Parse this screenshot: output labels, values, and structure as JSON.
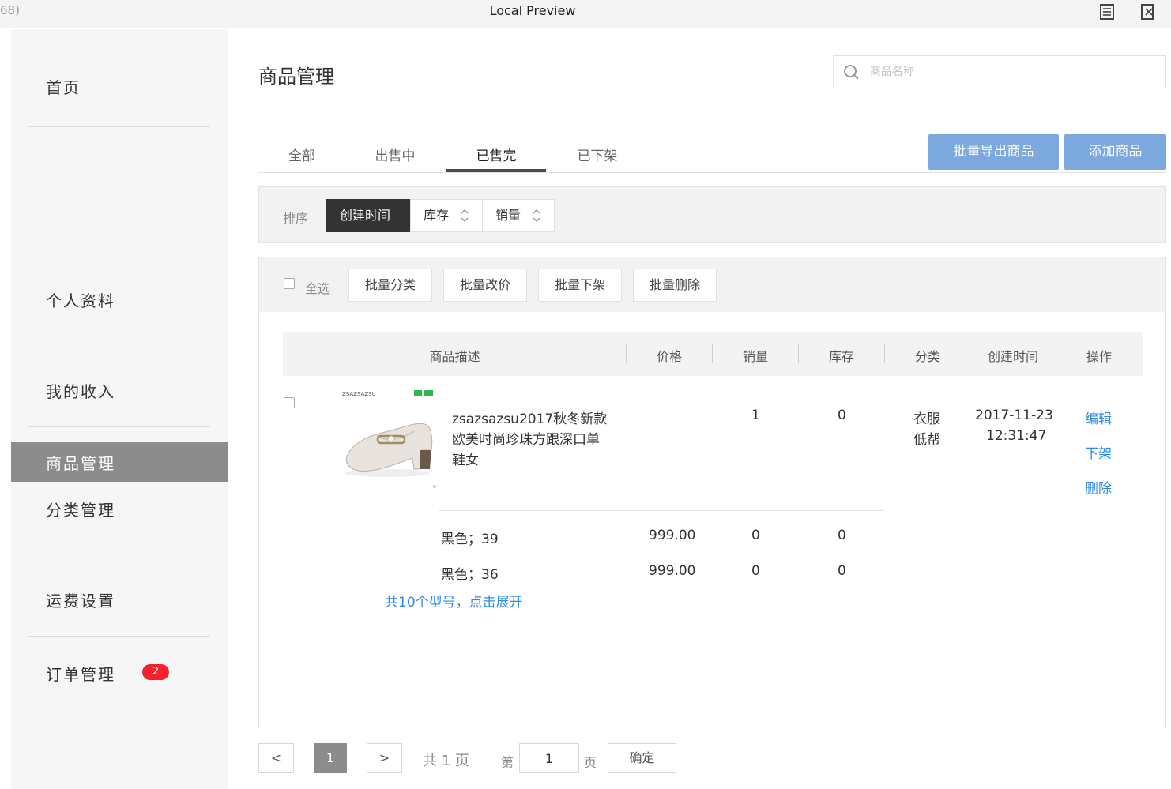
{
  "window": {
    "left_fragment": "68)",
    "title": "Local Preview"
  },
  "sidebar": {
    "items": [
      {
        "label": "首页"
      },
      {
        "label": "个人资料"
      },
      {
        "label": "我的收入"
      },
      {
        "label": "商品管理",
        "active": true
      },
      {
        "label": "分类管理"
      },
      {
        "label": "运费设置"
      },
      {
        "label": "订单管理",
        "badge": "2"
      }
    ]
  },
  "header": {
    "title": "商品管理",
    "search_placeholder": "商品名称"
  },
  "tabs": [
    {
      "label": "全部"
    },
    {
      "label": "出售中"
    },
    {
      "label": "已售完",
      "active": true
    },
    {
      "label": "已下架"
    }
  ],
  "actions": {
    "export": "批量导出商品",
    "add": "添加商品"
  },
  "sort": {
    "label": "排序",
    "options": [
      "创建时间",
      "库存",
      "销量"
    ],
    "active": "创建时间"
  },
  "batch": {
    "select_all": "全选",
    "buttons": [
      "批量分类",
      "批量改价",
      "批量下架",
      "批量删除"
    ]
  },
  "table": {
    "headers": [
      "商品描述",
      "价格",
      "销量",
      "库存",
      "分类",
      "创建时间",
      "操作"
    ],
    "product": {
      "brand_text": "ZSAZSAZSU",
      "desc_lines": [
        "zsazsazsu2017秋冬新款",
        "欧美时尚珍珠方跟深口单",
        "鞋女"
      ],
      "sales": "1",
      "stock": "0",
      "category_lines": [
        "衣服",
        "低帮"
      ],
      "created_date": "2017-11-23",
      "created_time": "12:31:47",
      "ops": [
        "编辑",
        "下架",
        "删除"
      ],
      "variants": [
        {
          "name": "黑色；39",
          "price": "999.00",
          "sales": "0",
          "stock": "0"
        },
        {
          "name": "黑色；36",
          "price": "999.00",
          "sales": "0",
          "stock": "0"
        }
      ],
      "expand": "共10个型号，点击展开"
    }
  },
  "pagination": {
    "prev": "<",
    "current": "1",
    "next": ">",
    "total": "共 1 页",
    "goto_prefix": "第",
    "goto_value": "1",
    "goto_suffix": "页",
    "confirm": "确定"
  },
  "colors": {
    "accent_blue": "#7ba9de",
    "link_blue": "#2f8be6",
    "sidebar_active": "#8c8c8c",
    "badge_red": "#f5222d"
  }
}
